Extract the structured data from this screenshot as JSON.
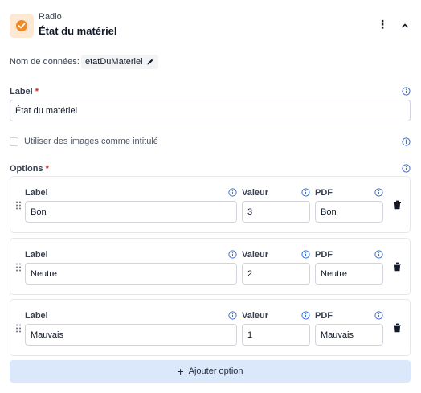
{
  "header": {
    "type_label": "Radio",
    "field_title": "État du matériel",
    "type_icon": "radio-check-icon",
    "menu_icon": "more-vertical-icon",
    "collapse_icon": "chevron-up-icon"
  },
  "data_name": {
    "label": "Nom de données:",
    "value": "etatDuMateriel",
    "edit_icon": "pencil-icon"
  },
  "label_section": {
    "label": "Label",
    "required_mark": "*",
    "value": "État du matériel"
  },
  "images_option": {
    "label": "Utiliser des images comme intitulé",
    "checked": false
  },
  "options_section": {
    "label": "Options",
    "required_mark": "*",
    "column_headers": {
      "label": "Label",
      "value": "Valeur",
      "pdf": "PDF"
    },
    "items": [
      {
        "label": "Bon",
        "value": "3",
        "pdf": "Bon"
      },
      {
        "label": "Neutre",
        "value": "2",
        "pdf": "Neutre"
      },
      {
        "label": "Mauvais",
        "value": "1",
        "pdf": "Mauvais"
      }
    ]
  },
  "add_button": {
    "plus": "+",
    "label": "Ajouter option"
  },
  "colors": {
    "accent_orange": "#f08a24",
    "add_button_bg": "#dbe7fb",
    "required_red": "#dc2626",
    "info_blue": "#3b6fd4"
  }
}
